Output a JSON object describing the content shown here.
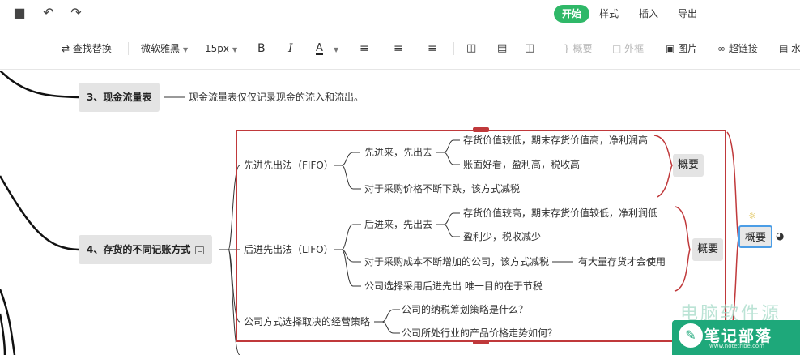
{
  "menu": {
    "items": [
      {
        "label": "开始",
        "active": true
      },
      {
        "label": "样式",
        "active": false
      },
      {
        "label": "插入",
        "active": false
      },
      {
        "label": "导出",
        "active": false
      }
    ]
  },
  "toolbar": {
    "find_replace": "查找替换",
    "font_family": "微软雅黑",
    "font_size": "15px",
    "bold": "B",
    "italic": "I",
    "font_color": "A",
    "summary": "概要",
    "frame": "外框",
    "image": "图片",
    "hyperlink": "超链接",
    "note": "水"
  },
  "mindmap": {
    "topic3": {
      "label": "3、现金流量表",
      "desc": "现金流量表仅仅记录现金的流入和流出。"
    },
    "topic4": {
      "label": "4、存货的不同记账方式"
    },
    "fifo": {
      "label": "先进先出法（FIFO）",
      "sub1": "先进来，先出去",
      "leaf1": "存货价值较低，期末存货价值高，净利润高",
      "leaf2": "账面好看，盈利高，税收高",
      "sub2": "对于采购价格不断下跌，该方式减税",
      "summary": "概要"
    },
    "lifo": {
      "label": "后进先出法（LIFO）",
      "sub1": "后进来，先出去",
      "leaf1": "存货价值较高，期末存货价值较低，净利润低",
      "leaf2": "盈利少，税收减少",
      "sub2": "对于采购成本不断增加的公司，该方式减税",
      "sub2_note": "有大量存货才会使用",
      "sub3": "公司选择采用后进先出 唯一目的在于节税",
      "summary": "概要"
    },
    "choice": {
      "label": "公司方式选择取决的经营策略",
      "leaf1": "公司的纳税筹划策略是什么？",
      "leaf2": "公司所处行业的产品价格走势如何？"
    },
    "outer_summary": "概要"
  },
  "watermark": {
    "title": "笔记部落",
    "faint": "电脑软件源网",
    "site": "www.notetribe.com"
  }
}
